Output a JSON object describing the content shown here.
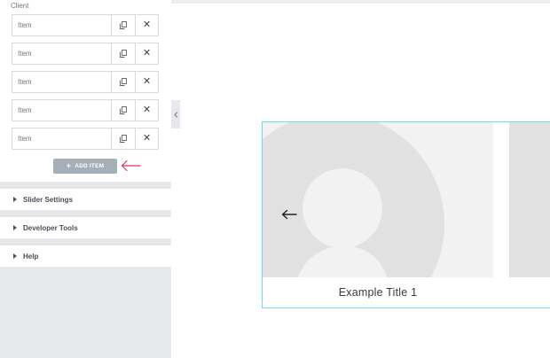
{
  "panel": {
    "section_label": "Client",
    "items": [
      {
        "title": "Item"
      },
      {
        "title": "Item"
      },
      {
        "title": "Item"
      },
      {
        "title": "Item"
      },
      {
        "title": "Item"
      }
    ],
    "add_item_label": "ADD ITEM",
    "accordion": [
      {
        "label": "Slider Settings"
      },
      {
        "label": "Developer Tools"
      },
      {
        "label": "Help"
      }
    ]
  },
  "preview": {
    "slide_title": "Example Title 1"
  },
  "colors": {
    "panel_bg": "#e6e8eb",
    "add_button": "#a4afb7",
    "pointer_arrow": "#d6336c",
    "slider_outline": "#71d7f7",
    "placeholder_bg": "#f2f2f2",
    "placeholder_shape": "#e1e1e1"
  }
}
